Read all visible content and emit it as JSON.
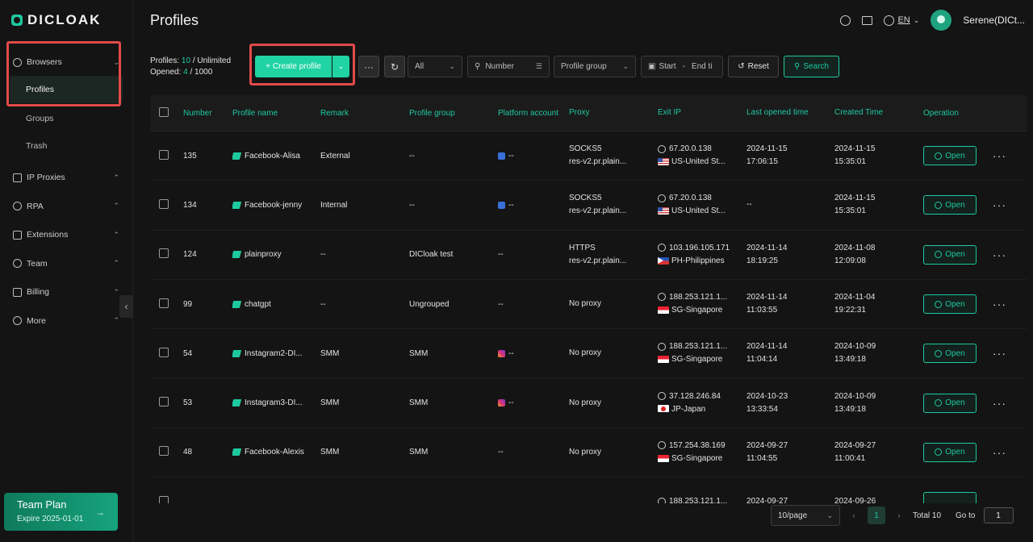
{
  "app": {
    "logo_text": "DICLOAK"
  },
  "sidebar": {
    "browsers_label": "Browsers",
    "items": [
      {
        "label": "Profiles"
      },
      {
        "label": "Groups"
      },
      {
        "label": "Trash"
      }
    ],
    "sections": [
      {
        "label": "IP Proxies"
      },
      {
        "label": "RPA"
      },
      {
        "label": "Extensions"
      },
      {
        "label": "Team"
      },
      {
        "label": "Billing"
      },
      {
        "label": "More"
      }
    ],
    "team_plan": {
      "title": "Team Plan",
      "expire": "Expire 2025-01-01"
    }
  },
  "header": {
    "title": "Profiles",
    "lang": "EN",
    "username": "Serene(DICt..."
  },
  "toolbar": {
    "profiles_label": "Profiles:",
    "profiles_count": "10",
    "profiles_limit": "/ Unlimited",
    "opened_label": "Opened:",
    "opened_count": "4",
    "opened_limit": "/ 1000",
    "create_label": "Create profile",
    "filter_all": "All",
    "number_placeholder": "Number",
    "profile_group_placeholder": "Profile group",
    "start_placeholder": "Start",
    "date_sep": "-",
    "end_placeholder": "End ti",
    "reset_label": "Reset",
    "search_label": "Search"
  },
  "table": {
    "headers": {
      "number": "Number",
      "name": "Profile name",
      "remark": "Remark",
      "group": "Profile group",
      "platform": "Platform account",
      "proxy": "Proxy",
      "exit_ip": "Exit IP",
      "last_opened": "Last opened time",
      "created": "Created Time",
      "operation": "Operation"
    },
    "open_label": "Open",
    "rows": [
      {
        "number": "135",
        "name": "Facebook-Alisa",
        "remark": "External",
        "group": "--",
        "platform": "--",
        "platform_icon": "facebook-icon",
        "proxy1": "SOCKS5",
        "proxy2": "res-v2.pr.plain...",
        "ip": "67.20.0.138",
        "country": "US-United St...",
        "flag": "us",
        "last1": "2024-11-15",
        "last2": "17:06:15",
        "created1": "2024-11-15",
        "created2": "15:35:01"
      },
      {
        "number": "134",
        "name": "Facebook-jenny",
        "remark": "Internal",
        "group": "--",
        "platform": "--",
        "platform_icon": "facebook-icon",
        "proxy1": "SOCKS5",
        "proxy2": "res-v2.pr.plain...",
        "ip": "67.20.0.138",
        "country": "US-United St...",
        "flag": "us",
        "last1": "--",
        "last2": "",
        "created1": "2024-11-15",
        "created2": "15:35:01"
      },
      {
        "number": "124",
        "name": "plainproxy",
        "remark": "--",
        "group": "DICloak test",
        "platform": "--",
        "platform_icon": "",
        "proxy1": "HTTPS",
        "proxy2": "res-v2.pr.plain...",
        "ip": "103.196.105.171",
        "country": "PH-Philippines",
        "flag": "ph",
        "last1": "2024-11-14",
        "last2": "18:19:25",
        "created1": "2024-11-08",
        "created2": "12:09:08"
      },
      {
        "number": "99",
        "name": "chatgpt",
        "remark": "--",
        "group": "Ungrouped",
        "platform": "--",
        "platform_icon": "",
        "proxy1": "No proxy",
        "proxy2": "",
        "ip": "188.253.121.1...",
        "country": "SG-Singapore",
        "flag": "sg",
        "last1": "2024-11-14",
        "last2": "11:03:55",
        "created1": "2024-11-04",
        "created2": "19:22:31"
      },
      {
        "number": "54",
        "name": "Instagram2-DI...",
        "remark": "SMM",
        "group": "SMM",
        "platform": "--",
        "platform_icon": "instagram-icon",
        "proxy1": "No proxy",
        "proxy2": "",
        "ip": "188.253.121.1...",
        "country": "SG-Singapore",
        "flag": "sg",
        "last1": "2024-11-14",
        "last2": "11:04:14",
        "created1": "2024-10-09",
        "created2": "13:49:18"
      },
      {
        "number": "53",
        "name": "Instagram3-DI...",
        "remark": "SMM",
        "group": "SMM",
        "platform": "--",
        "platform_icon": "instagram-icon",
        "proxy1": "No proxy",
        "proxy2": "",
        "ip": "37.128.246.84",
        "country": "JP-Japan",
        "flag": "jp",
        "last1": "2024-10-23",
        "last2": "13:33:54",
        "created1": "2024-10-09",
        "created2": "13:49:18"
      },
      {
        "number": "48",
        "name": "Facebook-Alexis",
        "remark": "SMM",
        "group": "SMM",
        "platform": "--",
        "platform_icon": "",
        "proxy1": "No proxy",
        "proxy2": "",
        "ip": "157.254.38.169",
        "country": "SG-Singapore",
        "flag": "sg",
        "last1": "2024-09-27",
        "last2": "11:04:55",
        "created1": "2024-09-27",
        "created2": "11:00:41"
      },
      {
        "number": "",
        "name": "",
        "remark": "",
        "group": "",
        "platform": "",
        "platform_icon": "",
        "proxy1": "",
        "proxy2": "",
        "ip": "188.253.121.1...",
        "country": "",
        "flag": "",
        "last1": "2024-09-27",
        "last2": "",
        "created1": "2024-09-26",
        "created2": ""
      }
    ]
  },
  "pagination": {
    "page_size": "10/page",
    "current_page": "1",
    "total": "Total 10",
    "goto_label": "Go to",
    "goto_value": "1"
  },
  "colors": {
    "accent": "#1ec9a0",
    "highlight_box": "#e24a4a",
    "background": "#141414"
  }
}
